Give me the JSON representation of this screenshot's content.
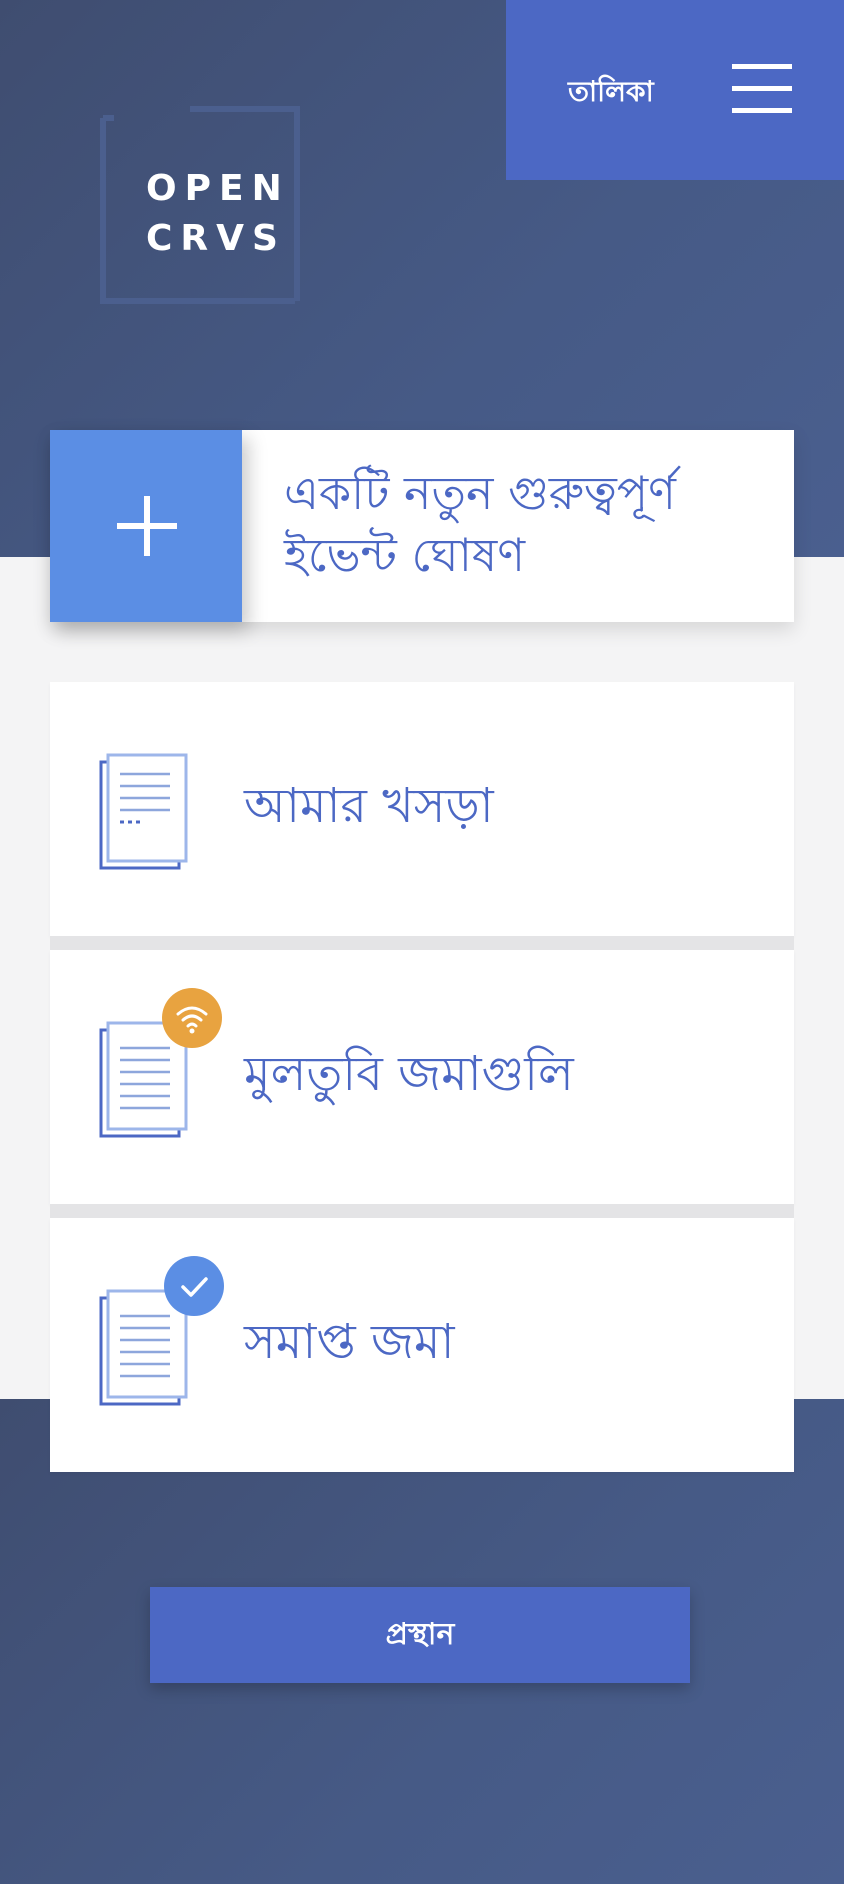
{
  "logo": {
    "line1": "OPEN",
    "line2": "CRVS"
  },
  "header": {
    "menu_label": "তালিকা"
  },
  "new_event": {
    "label": "একটি নতুন গুরুত্বপূর্ণ ইভেন্ট ঘোষণ"
  },
  "cards": [
    {
      "label": "আমার খসড়া",
      "icon": "drafts-document-icon"
    },
    {
      "label": "মুলতুবি জমাগুলি",
      "icon": "pending-document-icon",
      "badge": "wifi-icon",
      "badge_color": "#e8a340"
    },
    {
      "label": "সমাপ্ত জমা",
      "icon": "submitted-document-icon",
      "badge": "check-icon",
      "badge_color": "#5b8ee4"
    }
  ],
  "logout": {
    "label": "প্রস্থান"
  },
  "colors": {
    "primary": "#4c68c4",
    "accent": "#5b8ee4",
    "warning": "#e8a340",
    "header_bg": "#465a86"
  }
}
